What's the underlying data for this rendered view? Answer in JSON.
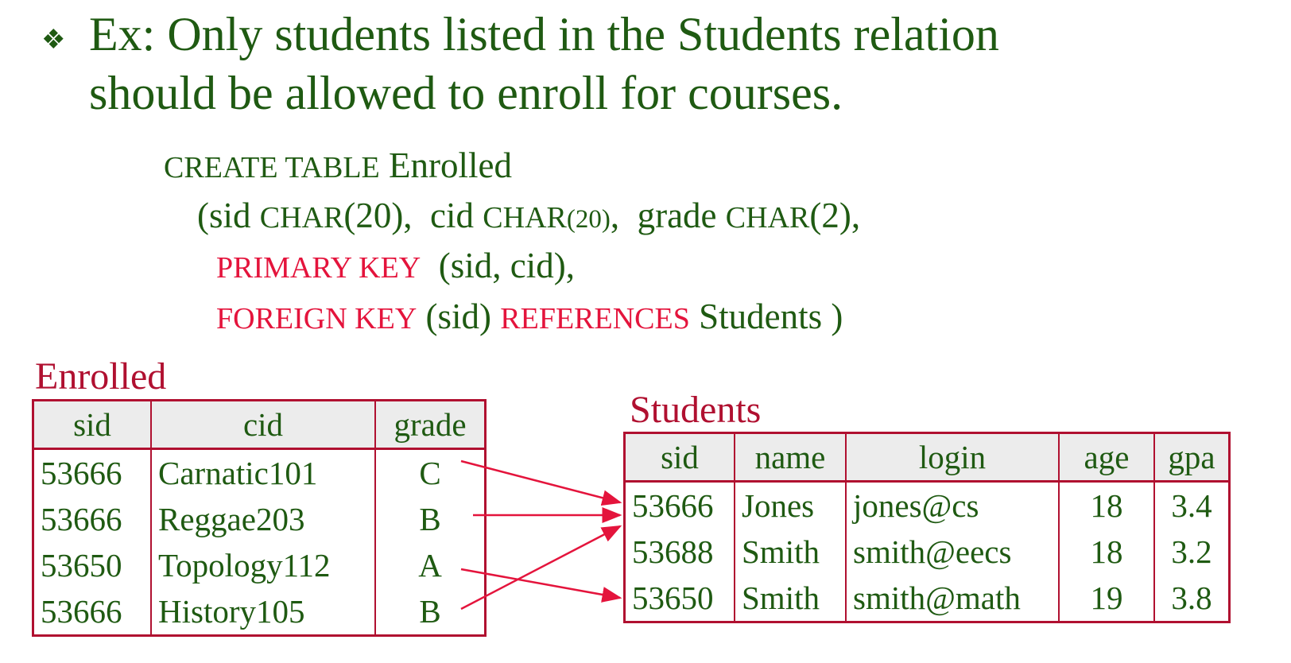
{
  "headline": {
    "bullet": "❖",
    "line1": "Ex:  Only students listed in the Students relation",
    "line2": "should be allowed to enroll for courses."
  },
  "code": {
    "l1_kw": "CREATE TABLE",
    "l1_name": "Enrolled",
    "l2_open": "(sid ",
    "l2_t1": "CHAR",
    "l2_p1": "(20),  cid ",
    "l2_t2": "CHAR",
    "l2_p2": "(20)",
    "l2_mid": ",  grade ",
    "l2_t3": "CHAR",
    "l2_p3": "(2),",
    "l3_kw": "PRIMARY KEY",
    "l3_rest": "(sid, cid),",
    "l4_kw": "FOREIGN KEY",
    "l4_mid": "(sid)",
    "l4_kw2": "REFERENCES",
    "l4_rest": "Students )"
  },
  "enrolled": {
    "title": "Enrolled",
    "headers": [
      "sid",
      "cid",
      "grade"
    ],
    "rows": [
      [
        "53666",
        "Carnatic101",
        "C"
      ],
      [
        "53666",
        "Reggae203",
        "B"
      ],
      [
        "53650",
        "Topology112",
        "A"
      ],
      [
        "53666",
        "History105",
        "B"
      ]
    ]
  },
  "students": {
    "title": "Students",
    "headers": [
      "sid",
      "name",
      "login",
      "age",
      "gpa"
    ],
    "rows": [
      [
        "53666",
        "Jones",
        "jones@cs",
        "18",
        "3.4"
      ],
      [
        "53688",
        "Smith",
        "smith@eecs",
        "18",
        "3.2"
      ],
      [
        "53650",
        "Smith",
        "smith@math",
        "19",
        "3.8"
      ]
    ]
  },
  "colors": {
    "text_green": "#1f5a12",
    "keyword_red": "#e4143c",
    "table_border": "#b01030",
    "arrow": "#e4143c"
  }
}
